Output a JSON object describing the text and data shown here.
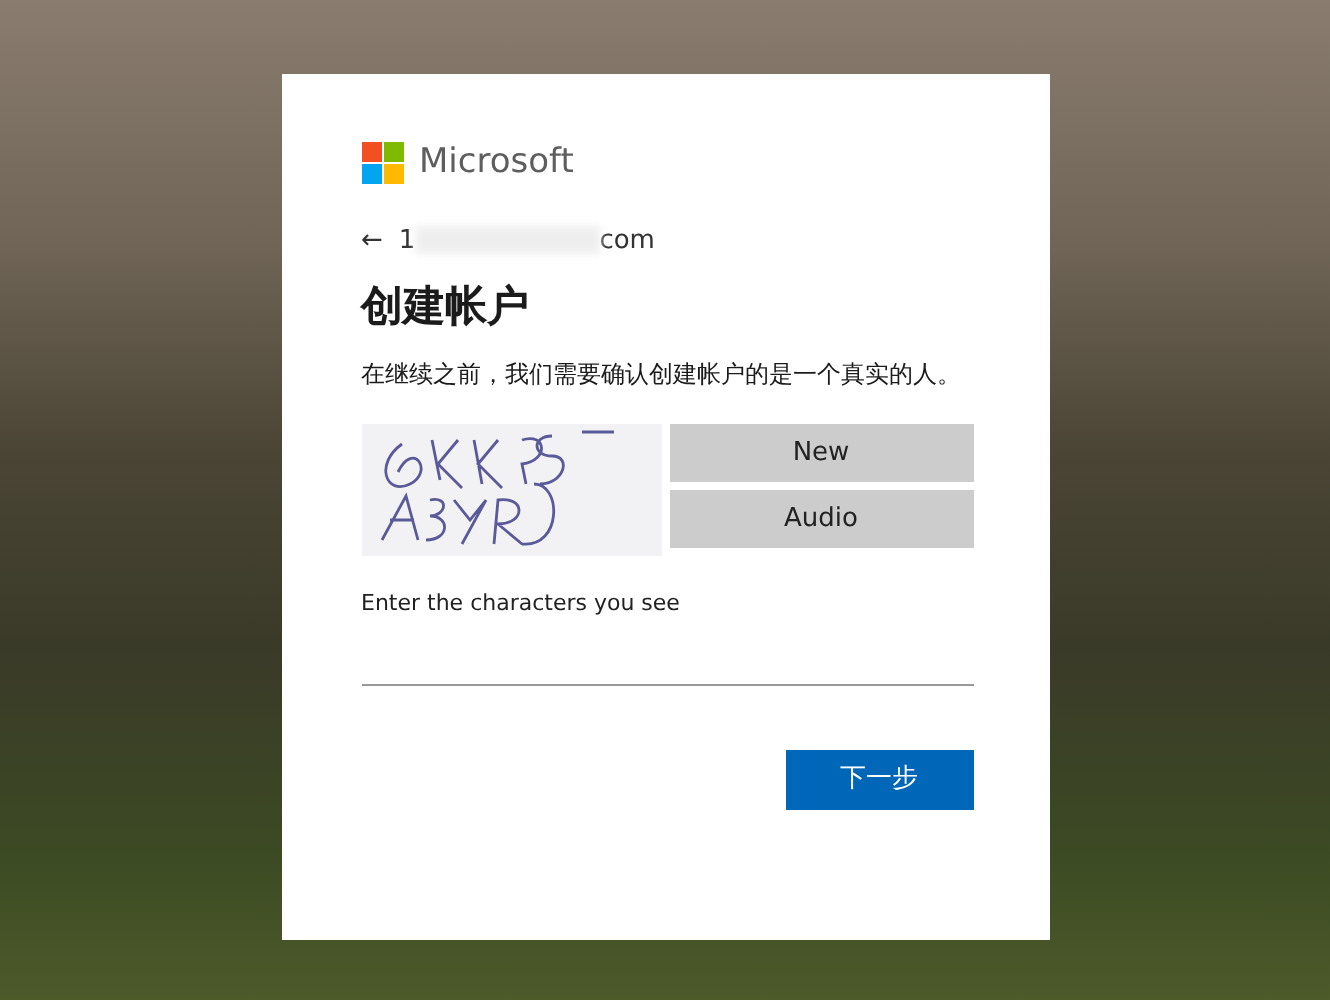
{
  "brand": {
    "name": "Microsoft"
  },
  "account": {
    "back": "←",
    "email_start": "1",
    "email_end": "com"
  },
  "title": "创建帐户",
  "description": "在继续之前，我们需要确认创建帐户的是一个真实的人。",
  "captcha": {
    "buttons": [
      "New",
      "Audio"
    ]
  },
  "field": {
    "label": "Enter the characters you see"
  },
  "next_button": "下一步"
}
